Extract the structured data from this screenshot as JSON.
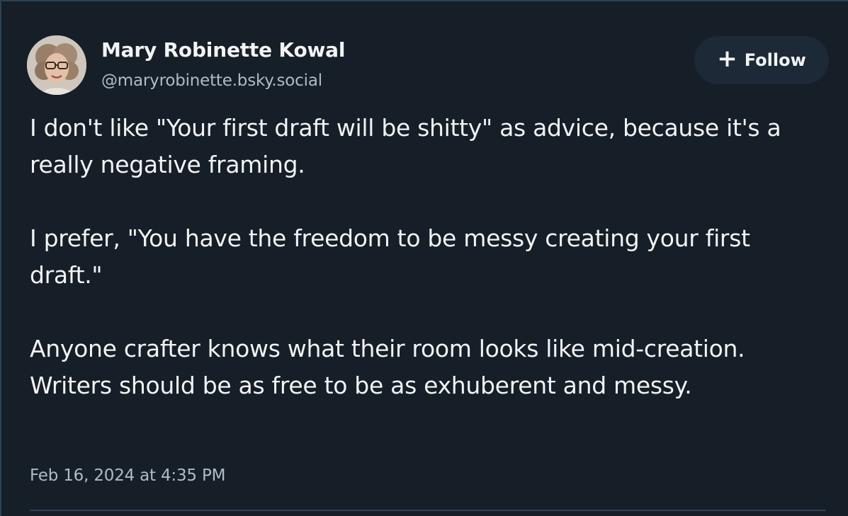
{
  "author": {
    "display_name": "Mary Robinette Kowal",
    "handle": "@maryrobinette.bsky.social",
    "avatar_icon": "user-avatar"
  },
  "follow_button": {
    "icon": "plus-icon",
    "icon_glyph": "+",
    "label": "Follow"
  },
  "post": {
    "paragraphs": [
      "I don't like \"Your first draft will be shitty\" as advice, because it's a really negative framing.",
      "I prefer, \"You have the freedom to be messy creating your first draft.\"",
      "Anyone crafter knows what their room looks like mid-creation. Writers should be as free to be as exhuberent and messy."
    ],
    "timestamp": "Feb 16, 2024 at 4:35 PM"
  },
  "colors": {
    "background": "#161e27",
    "border": "#2e4154",
    "text_primary": "#f1f3f5",
    "text_secondary": "#aebbc9",
    "button_bg": "#1e2937"
  }
}
